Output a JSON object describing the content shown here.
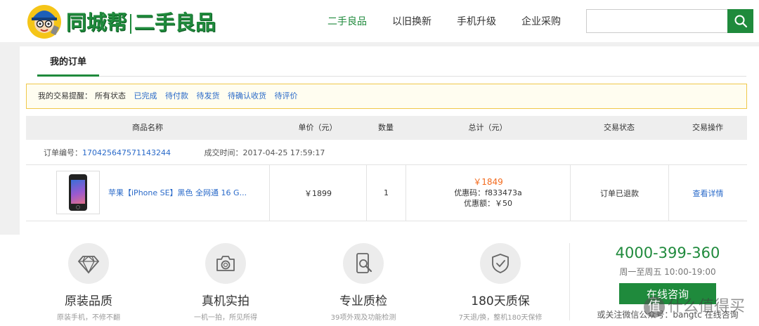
{
  "header": {
    "logo_text_left": "同城帮",
    "logo_text_right": "二手良品",
    "nav": [
      {
        "label": "二手良品",
        "active": true
      },
      {
        "label": "以旧换新",
        "active": false
      },
      {
        "label": "手机升级",
        "active": false
      },
      {
        "label": "企业采购",
        "active": false
      }
    ],
    "search_placeholder": "",
    "icon": "search-icon"
  },
  "orders": {
    "tab_label": "我的订单",
    "reminder": {
      "prefix": "我的交易提醒：",
      "current": "所有状态",
      "links": [
        "已完成",
        "待付款",
        "待发货",
        "待确认收货",
        "待评价"
      ]
    },
    "columns": [
      "商品名称",
      "单价（元）",
      "数量",
      "总计（元）",
      "交易状态",
      "交易操作"
    ],
    "order": {
      "number_label": "订单编号：",
      "number": "170425647571143244",
      "time_label": "成交时间：",
      "time": "2017-04-25 17:59:17",
      "product_name": "苹果【iPhone SE】黑色 全网通 16 G...",
      "unit_price": "￥1899",
      "quantity": "1",
      "total": "￥1849",
      "coupon_code": "优惠码：f833473a",
      "coupon_amount": "优惠额：￥50",
      "status": "订单已退款",
      "action": "查看详情"
    }
  },
  "footer": {
    "features": [
      {
        "title": "原装品质",
        "subtitle": "原装手机，不修不翻",
        "icon": "diamond-icon"
      },
      {
        "title": "真机实拍",
        "subtitle": "一机一拍，所见所得",
        "icon": "camera-icon"
      },
      {
        "title": "专业质检",
        "subtitle": "39项外观及功能检测",
        "icon": "phone-inspect-icon"
      },
      {
        "title": "180天质保",
        "subtitle": "7天退/换，整机180天保修",
        "icon": "shield-check-icon"
      }
    ],
    "hotline": "4000-399-360",
    "hours": "周一至周五 10:00-19:00",
    "consult_label": "在线咨询",
    "wechat": "或关注微信公众号：bangtc 在线咨询"
  },
  "watermark": {
    "badge": "值",
    "text": "什么值得买"
  },
  "colors": {
    "brand_green": "#1f8a3c",
    "link_blue": "#2a6ac9",
    "price_orange": "#f36a1d",
    "reminder_border": "#f0c84a"
  }
}
